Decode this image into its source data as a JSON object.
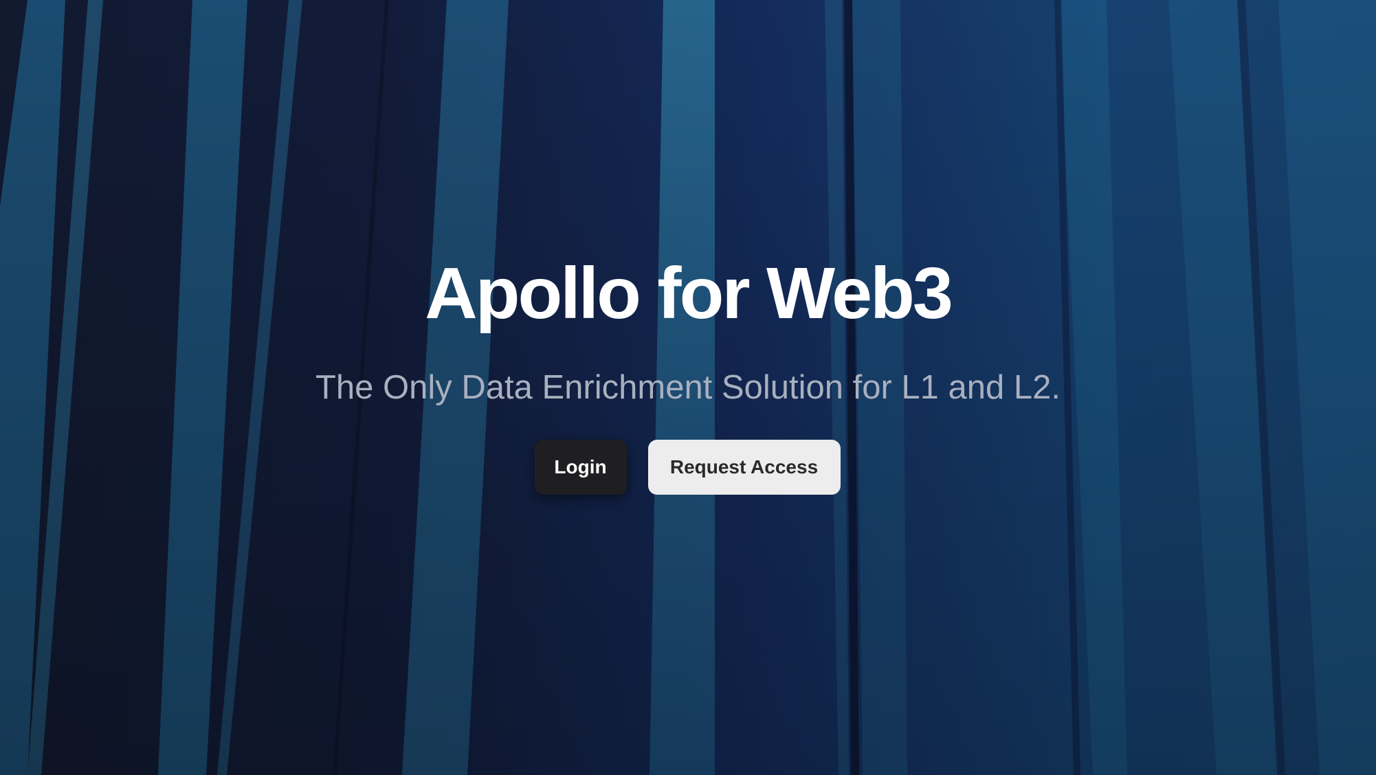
{
  "hero": {
    "title": "Apollo for Web3",
    "subtitle": "The Only Data Enrichment Solution for L1 and L2.",
    "background_image": "abstract-blue-vertical-stripes"
  },
  "actions": {
    "login_label": "Login",
    "request_access_label": "Request Access"
  },
  "colors": {
    "background_dark": "#121a33",
    "background_blue": "#1a4f86",
    "title": "#ffffff",
    "subtitle": "#a9b0bf",
    "login_button_bg": "#1f1f22",
    "request_button_bg": "#ededee"
  }
}
